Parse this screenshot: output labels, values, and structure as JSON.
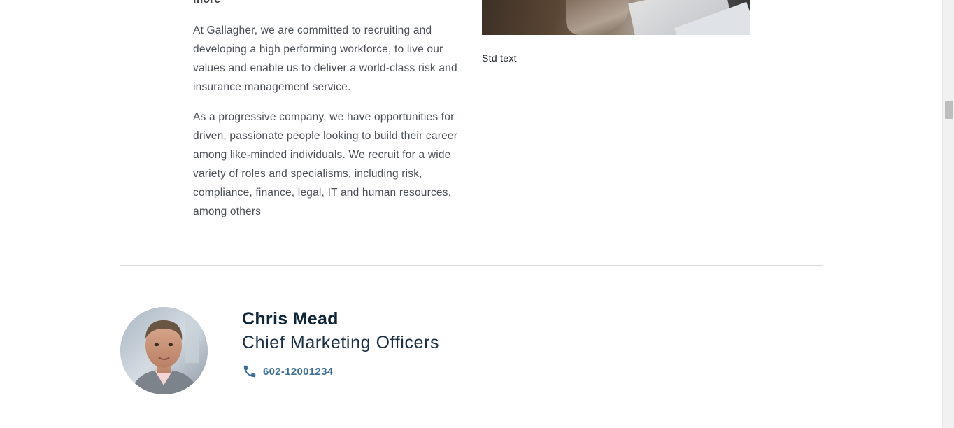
{
  "article": {
    "heading_fragment": "more",
    "paragraphs": [
      "At Gallagher, we are committed to recruiting and developing a high performing workforce, to live our values and enable us to deliver a world-class risk and insurance management service.",
      "As a progressive company, we have opportunities for driven, passionate people looking to build their career among like-minded individuals. We recruit for a wide variety of roles and specialisms, including risk, compliance, finance, legal, IT and human resources, among others"
    ]
  },
  "media": {
    "caption": "Std text"
  },
  "contact": {
    "name": "Chris Mead",
    "title": "Chief Marketing Officers",
    "phone": "602-12001234",
    "phone_icon": "phone-icon"
  },
  "colors": {
    "name_text": "#0f2538",
    "phone_link": "#3e6f95",
    "body_text": "#4b4f55",
    "divider": "#d6d9dc"
  }
}
